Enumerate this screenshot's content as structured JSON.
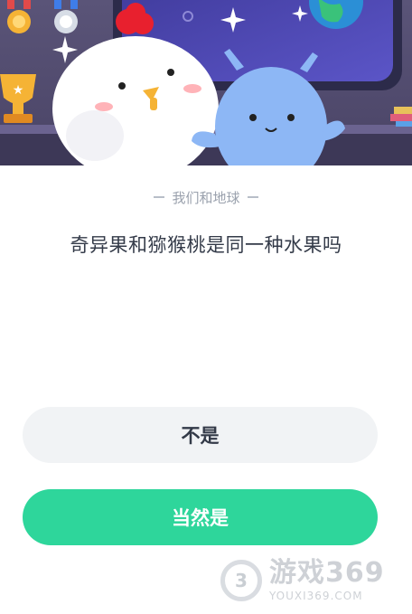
{
  "quiz": {
    "category": "我们和地球",
    "question": "奇异果和猕猴桃是同一种水果吗"
  },
  "answers": [
    {
      "label": "不是"
    },
    {
      "label": "当然是"
    }
  ],
  "watermark": {
    "logo_digit": "3",
    "name": "游戏369",
    "url": "YOUXI369.COM"
  },
  "colors": {
    "primary_button": "#2ed69b",
    "secondary_button": "#f1f3f5",
    "question_text": "#333a48",
    "category_text": "#9aa1ad"
  },
  "icons": [
    "medal-icon",
    "trophy-icon",
    "earth-icon",
    "sparkle-icon",
    "chicken-mascot",
    "alien-mascot"
  ]
}
